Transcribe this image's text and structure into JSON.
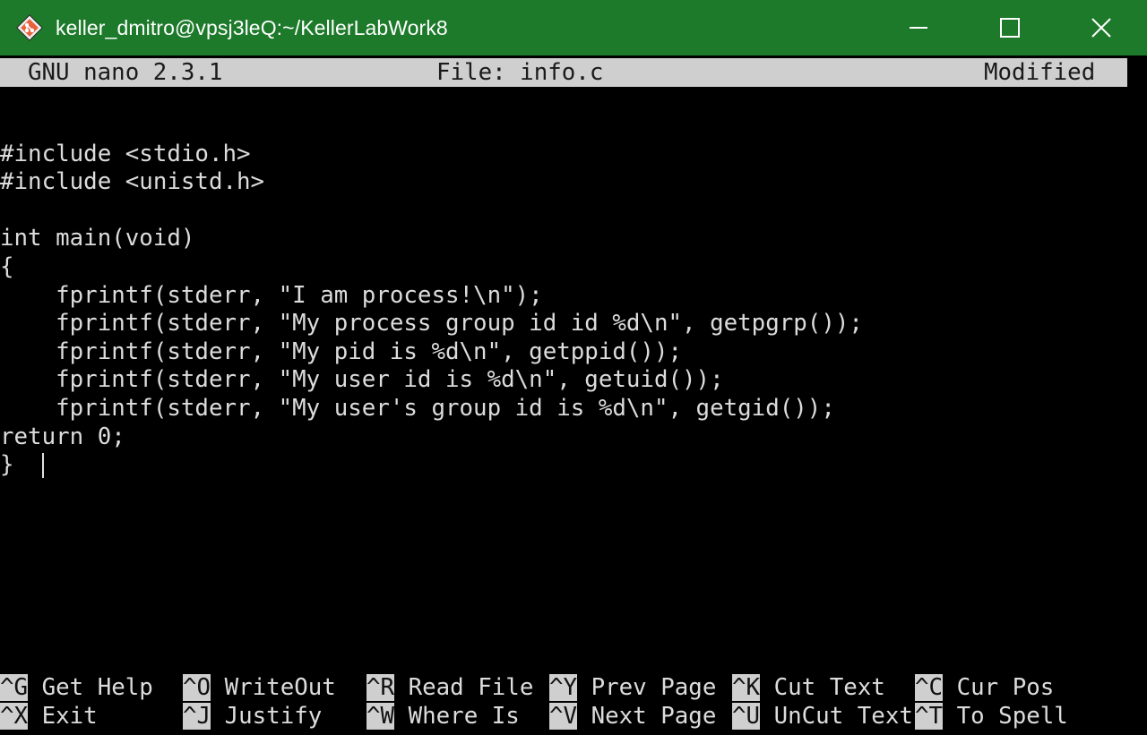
{
  "titlebar": {
    "title": "keller_dmitro@vpsj3leQ:~/KellerLabWork8",
    "icon": "git-diamond-icon",
    "color": "#1c7a2a",
    "controls": [
      "minimize-icon",
      "maximize-icon",
      "close-icon"
    ]
  },
  "nano": {
    "version": "GNU nano 2.3.1",
    "file": "File: info.c",
    "status": "Modified"
  },
  "code": [
    "",
    "#include <stdio.h>",
    "#include <unistd.h>",
    "",
    "int main(void)",
    "{",
    "    fprintf(stderr, \"I am process!\\n\");",
    "    fprintf(stderr, \"My process group id id %d\\n\", getpgrp());",
    "    fprintf(stderr, \"My pid is %d\\n\", getppid());",
    "    fprintf(stderr, \"My user id is %d\\n\", getuid());",
    "    fprintf(stderr, \"My user's group id is %d\\n\", getgid());",
    "return 0;",
    "}  "
  ],
  "shortcuts": {
    "row1": [
      {
        "key": "^G",
        "label": " Get Help"
      },
      {
        "key": "^O",
        "label": " WriteOut"
      },
      {
        "key": "^R",
        "label": " Read File"
      },
      {
        "key": "^Y",
        "label": " Prev Page"
      },
      {
        "key": "^K",
        "label": " Cut Text"
      },
      {
        "key": "^C",
        "label": " Cur Pos"
      }
    ],
    "row2": [
      {
        "key": "^X",
        "label": " Exit"
      },
      {
        "key": "^J",
        "label": " Justify"
      },
      {
        "key": "^W",
        "label": " Where Is"
      },
      {
        "key": "^V",
        "label": " Next Page"
      },
      {
        "key": "^U",
        "label": " UnCut Text"
      },
      {
        "key": "^T",
        "label": " To Spell"
      }
    ]
  }
}
